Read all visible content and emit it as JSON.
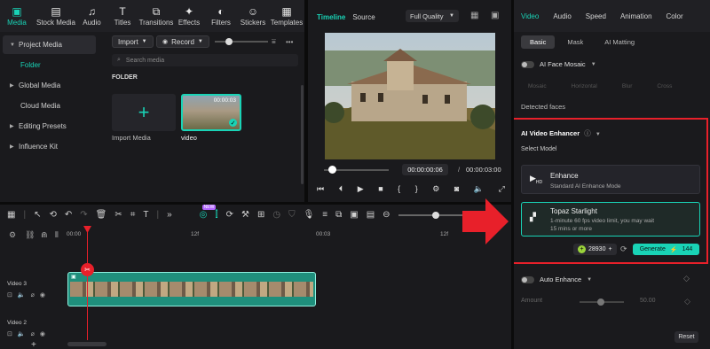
{
  "media_tabs": [
    {
      "label": "Media",
      "icon": "media-icon"
    },
    {
      "label": "Stock Media",
      "icon": "stock-media-icon"
    },
    {
      "label": "Audio",
      "icon": "audio-icon"
    },
    {
      "label": "Titles",
      "icon": "titles-icon"
    },
    {
      "label": "Transitions",
      "icon": "transitions-icon"
    },
    {
      "label": "Effects",
      "icon": "effects-icon"
    },
    {
      "label": "Filters",
      "icon": "filters-icon"
    },
    {
      "label": "Stickers",
      "icon": "stickers-icon"
    },
    {
      "label": "Templates",
      "icon": "templates-icon"
    }
  ],
  "sidebar": {
    "items": [
      "Project Media",
      "Folder",
      "Global Media",
      "Cloud Media",
      "Editing Presets",
      "Influence Kit"
    ]
  },
  "media_toolbar": {
    "import_label": "Import",
    "record_label": "Record"
  },
  "search": {
    "placeholder": "Search media"
  },
  "folder_label": "FOLDER",
  "import_card_label": "Import Media",
  "video_card": {
    "label": "video",
    "duration": "00:00:03"
  },
  "preview": {
    "tab_timeline": "Timeline",
    "tab_source": "Source",
    "quality": "Full Quality",
    "current_time": "00:00:00:06",
    "separator": "/",
    "total_time": "00:00:03:00"
  },
  "right_tabs": [
    "Video",
    "Audio",
    "Speed",
    "Animation",
    "Color"
  ],
  "sub_tabs": [
    "Basic",
    "Mask",
    "AI Matting"
  ],
  "face_mosaic": {
    "label": "AI Face Mosaic",
    "options": [
      "Mosaic",
      "Horizontal",
      "Blur",
      "Cross"
    ],
    "detected": "Detected faces"
  },
  "enhancer": {
    "title": "AI Video Enhancer",
    "select_model": "Select Model",
    "models": [
      {
        "title": "Enhance",
        "subtitle": "Standard AI Enhance Mode",
        "icon": "hd-icon"
      },
      {
        "title": "Topaz Starlight",
        "subtitle_line1": "1-minute 60 fps video limit, you may wait",
        "subtitle_line2": "15 mins or more",
        "icon": "topaz-icon"
      }
    ],
    "credits": "28930",
    "generate_label": "Generate",
    "generate_cost": "144"
  },
  "auto_enhance": {
    "label": "Auto Enhance",
    "amount_label": "Amount",
    "amount_value": "50.00"
  },
  "reset_label": "Reset",
  "timeline": {
    "ruler_labels": [
      "00:00",
      "12f",
      "00:03",
      "12f"
    ],
    "tracks": [
      "Video 3",
      "Video 2"
    ],
    "ai_badge": "NEW"
  },
  "colors": {
    "accent": "#19d3b6",
    "highlight": "#e8202a"
  }
}
